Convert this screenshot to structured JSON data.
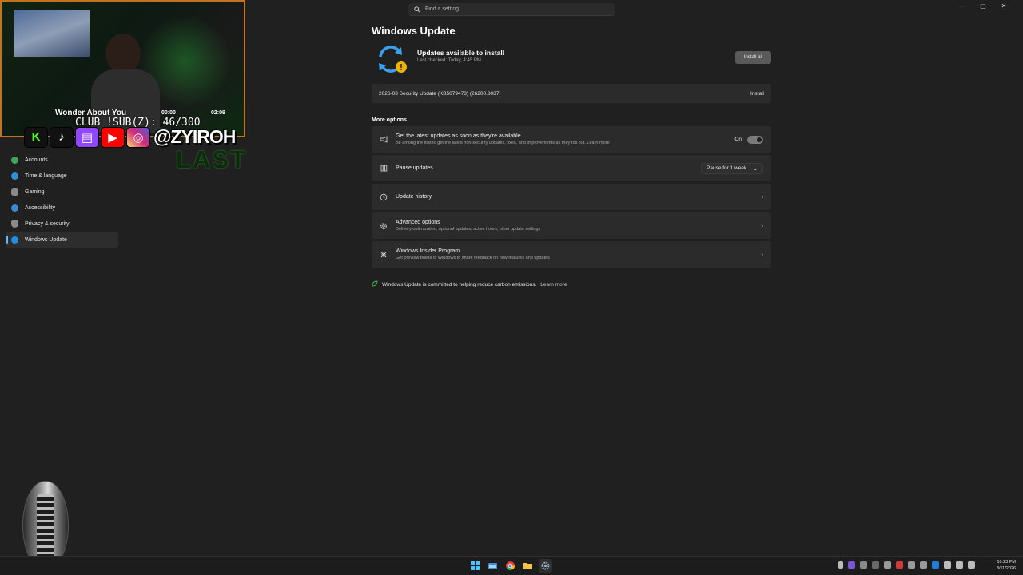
{
  "window": {
    "search_placeholder": "Find a setting",
    "controls": [
      "—",
      "▢",
      "✕"
    ]
  },
  "sidebar": {
    "items": [
      {
        "label": "Accounts",
        "icon": "person-icon",
        "color": "#3fa55b",
        "active": false
      },
      {
        "label": "Time & language",
        "icon": "globe-clock-icon",
        "color": "#2f8fd8",
        "active": false
      },
      {
        "label": "Gaming",
        "icon": "controller-icon",
        "color": "#8a8a8a",
        "active": false
      },
      {
        "label": "Accessibility",
        "icon": "accessibility-icon",
        "color": "#3b8bd4",
        "active": false
      },
      {
        "label": "Privacy & security",
        "icon": "shield-icon",
        "color": "#8a8a8a",
        "active": false
      },
      {
        "label": "Windows Update",
        "icon": "update-icon",
        "color": "#1f8fe5",
        "active": true
      }
    ]
  },
  "main": {
    "title": "Windows Update",
    "status": {
      "title": "Updates available to install",
      "subtitle": "Last checked: Today, 4:45 PM",
      "button": "Install all",
      "icon": "sync-warning-icon"
    },
    "pending_update": {
      "name": "2026-03 Security Update (KB5079473) (26200.8037)",
      "button": "Install"
    },
    "more_options_title": "More options",
    "options": {
      "latest": {
        "title": "Get the latest updates as soon as they're available",
        "subtitle": "Be among the first to get the latest non-security updates, fixes, and improvements as they roll out.",
        "link": "Learn more",
        "toggle_label": "On",
        "icon": "megaphone-icon"
      },
      "pause": {
        "title": "Pause updates",
        "select_value": "Pause for 1 week",
        "icon": "pause-icon"
      },
      "history": {
        "title": "Update history",
        "icon": "history-icon"
      },
      "advanced": {
        "title": "Advanced options",
        "subtitle": "Delivery optimization, optional updates, active hours, other update settings",
        "icon": "gear-icon"
      },
      "insider": {
        "title": "Windows Insider Program",
        "subtitle": "Get preview builds of Windows to share feedback on new features and updates",
        "icon": "insider-icon"
      }
    },
    "carbon": {
      "text": "Windows Update is committed to helping reduce carbon emissions.",
      "link": "Learn more",
      "icon": "leaf-icon"
    }
  },
  "overlay": {
    "song": "Wonder About You",
    "time_elapsed": "00:00",
    "time_total": "02:09",
    "sub_counter": "CLUB !SUB(Z): 46/300",
    "handle": "@ZYIROH",
    "last_text": "LAST",
    "colors": {
      "border": "#c4721c",
      "kick": "#53fc18",
      "twitch": "#9146ff",
      "youtube": "#ff0000",
      "instagram": "#e1306c"
    }
  },
  "taskbar": {
    "apps": [
      "windows-start-icon",
      "file-explorer-icon",
      "chrome-icon",
      "folder-icon",
      "settings-icon"
    ],
    "time": "10:23 PM",
    "date": "3/11/2026"
  }
}
